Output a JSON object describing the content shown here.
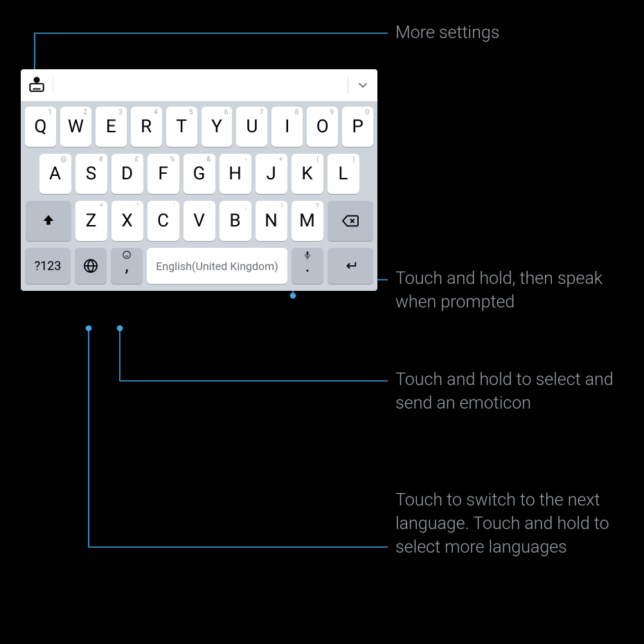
{
  "annotations": {
    "more_settings": "More settings",
    "mic": "Touch and hold, then speak when prompted",
    "emoji": "Touch and hold to select and send an emoticon",
    "globe": "Touch to switch to the next language. Touch and hold to select more languages"
  },
  "keyboard": {
    "row1": [
      {
        "main": "Q",
        "alt": "1"
      },
      {
        "main": "W",
        "alt": "2"
      },
      {
        "main": "E",
        "alt": "3"
      },
      {
        "main": "R",
        "alt": "4"
      },
      {
        "main": "T",
        "alt": "5"
      },
      {
        "main": "Y",
        "alt": "6"
      },
      {
        "main": "U",
        "alt": "7"
      },
      {
        "main": "I",
        "alt": "8"
      },
      {
        "main": "O",
        "alt": "9"
      },
      {
        "main": "P",
        "alt": "0"
      }
    ],
    "row2": [
      {
        "main": "A",
        "alt": "@"
      },
      {
        "main": "S",
        "alt": "#"
      },
      {
        "main": "D",
        "alt": "£"
      },
      {
        "main": "F",
        "alt": "%"
      },
      {
        "main": "G",
        "alt": "&"
      },
      {
        "main": "H",
        "alt": "-"
      },
      {
        "main": "J",
        "alt": "+"
      },
      {
        "main": "K",
        "alt": "("
      },
      {
        "main": "L",
        "alt": ")"
      }
    ],
    "row3": [
      {
        "main": "Z",
        "alt": "*"
      },
      {
        "main": "X",
        "alt": "\""
      },
      {
        "main": "C",
        "alt": "'"
      },
      {
        "main": "V",
        "alt": ":"
      },
      {
        "main": "B",
        "alt": ";"
      },
      {
        "main": "N",
        "alt": "!"
      },
      {
        "main": "M",
        "alt": "?"
      }
    ],
    "numeric_label": "?123",
    "comma": ",",
    "period": ".",
    "spacebar": "English(United Kingdom)"
  }
}
